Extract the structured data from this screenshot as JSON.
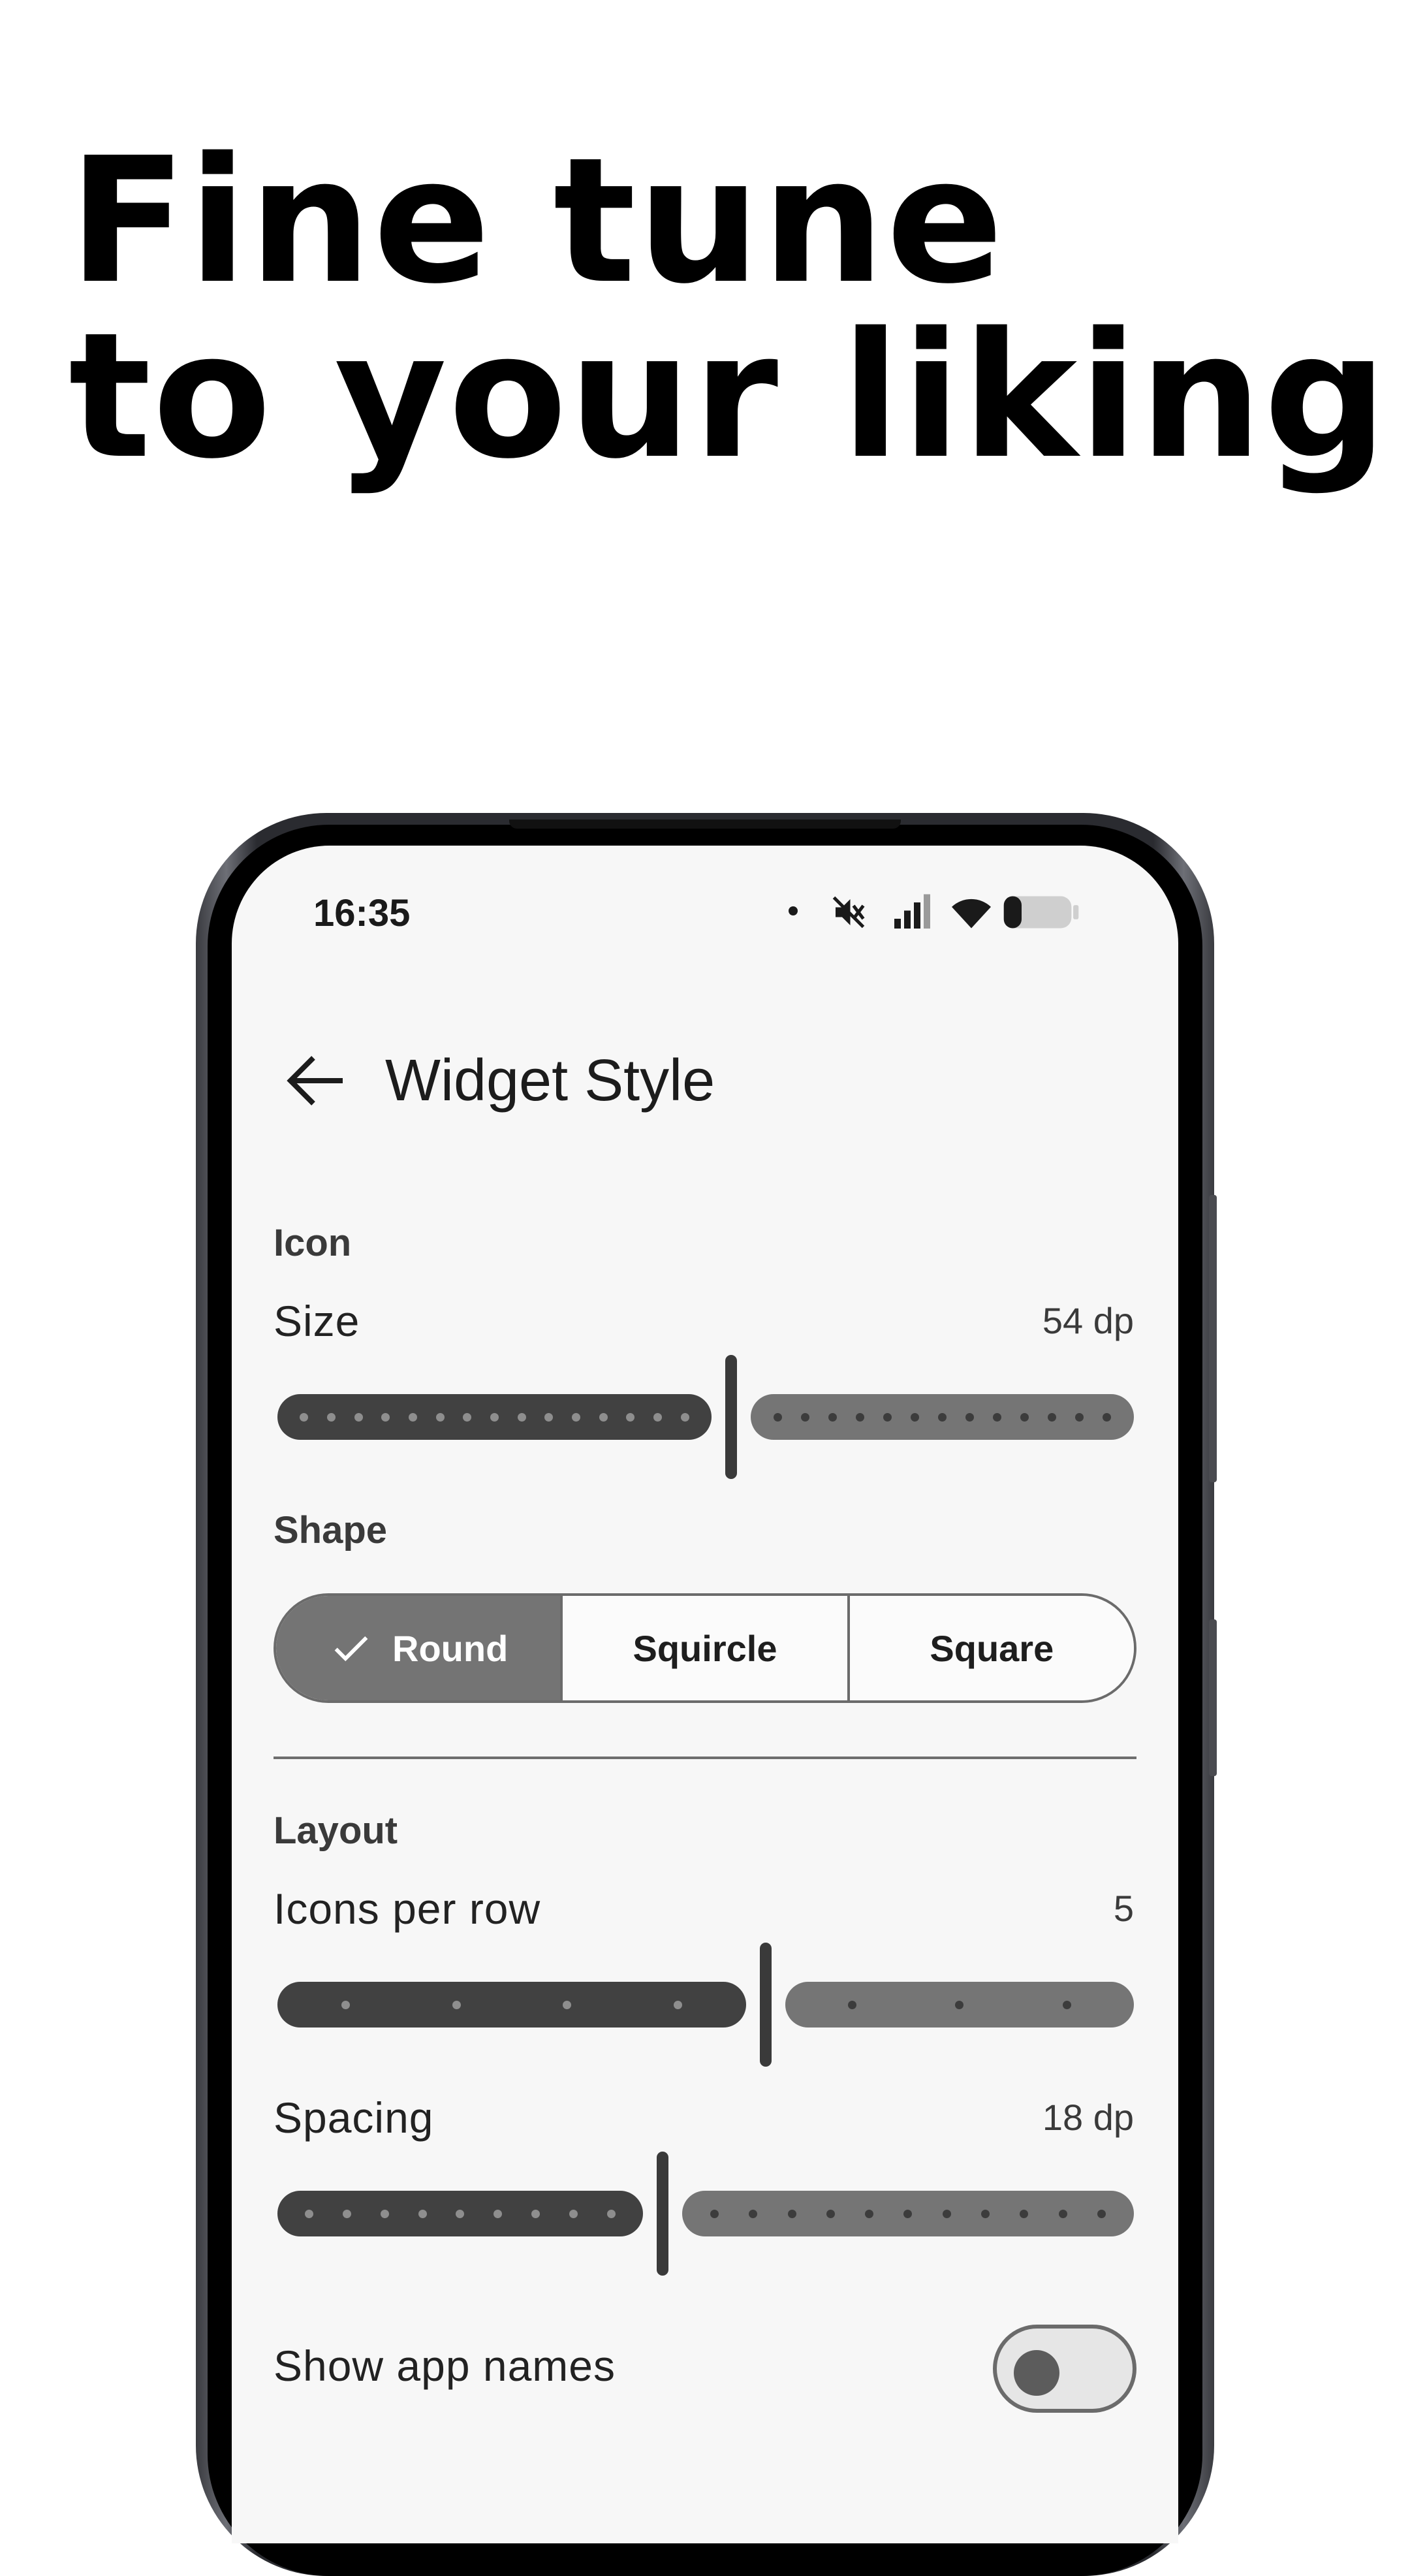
{
  "headline": {
    "line1": "Fine tune",
    "line2": "to your liking"
  },
  "status_bar": {
    "time": "16:35",
    "icons": [
      "notification-dot-icon",
      "mute-icon",
      "signal-icon",
      "wifi-icon",
      "battery-icon"
    ]
  },
  "app_bar": {
    "back_icon": "arrow-back-icon",
    "title": "Widget Style"
  },
  "icon_section": {
    "header": "Icon",
    "size": {
      "label": "Size",
      "value": "54 dp",
      "fraction": 0.53
    },
    "shape": {
      "header": "Shape",
      "options": [
        "Round",
        "Squircle",
        "Square"
      ],
      "selected": "Round"
    }
  },
  "layout_section": {
    "header": "Layout",
    "icons_per_row": {
      "label": "Icons per row",
      "value": "5",
      "fraction": 0.57
    },
    "spacing": {
      "label": "Spacing",
      "value": "18 dp",
      "fraction": 0.45
    },
    "show_app_names": {
      "label": "Show app names",
      "enabled": false
    }
  },
  "colors": {
    "background": "#ffffff",
    "screen": "#f7f7f7",
    "active_track": "#414141",
    "inactive_track": "#757575",
    "selected_segment": "#747474"
  }
}
